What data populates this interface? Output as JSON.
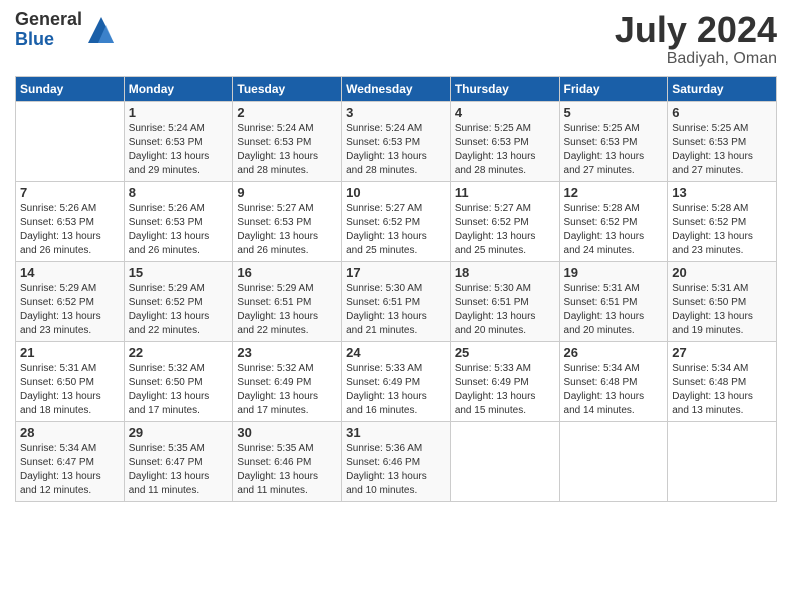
{
  "logo": {
    "general": "General",
    "blue": "Blue"
  },
  "title": "July 2024",
  "location": "Badiyah, Oman",
  "headers": [
    "Sunday",
    "Monday",
    "Tuesday",
    "Wednesday",
    "Thursday",
    "Friday",
    "Saturday"
  ],
  "weeks": [
    [
      {
        "day": "",
        "info": ""
      },
      {
        "day": "1",
        "info": "Sunrise: 5:24 AM\nSunset: 6:53 PM\nDaylight: 13 hours\nand 29 minutes."
      },
      {
        "day": "2",
        "info": "Sunrise: 5:24 AM\nSunset: 6:53 PM\nDaylight: 13 hours\nand 28 minutes."
      },
      {
        "day": "3",
        "info": "Sunrise: 5:24 AM\nSunset: 6:53 PM\nDaylight: 13 hours\nand 28 minutes."
      },
      {
        "day": "4",
        "info": "Sunrise: 5:25 AM\nSunset: 6:53 PM\nDaylight: 13 hours\nand 28 minutes."
      },
      {
        "day": "5",
        "info": "Sunrise: 5:25 AM\nSunset: 6:53 PM\nDaylight: 13 hours\nand 27 minutes."
      },
      {
        "day": "6",
        "info": "Sunrise: 5:25 AM\nSunset: 6:53 PM\nDaylight: 13 hours\nand 27 minutes."
      }
    ],
    [
      {
        "day": "7",
        "info": "Sunrise: 5:26 AM\nSunset: 6:53 PM\nDaylight: 13 hours\nand 26 minutes."
      },
      {
        "day": "8",
        "info": "Sunrise: 5:26 AM\nSunset: 6:53 PM\nDaylight: 13 hours\nand 26 minutes."
      },
      {
        "day": "9",
        "info": "Sunrise: 5:27 AM\nSunset: 6:53 PM\nDaylight: 13 hours\nand 26 minutes."
      },
      {
        "day": "10",
        "info": "Sunrise: 5:27 AM\nSunset: 6:52 PM\nDaylight: 13 hours\nand 25 minutes."
      },
      {
        "day": "11",
        "info": "Sunrise: 5:27 AM\nSunset: 6:52 PM\nDaylight: 13 hours\nand 25 minutes."
      },
      {
        "day": "12",
        "info": "Sunrise: 5:28 AM\nSunset: 6:52 PM\nDaylight: 13 hours\nand 24 minutes."
      },
      {
        "day": "13",
        "info": "Sunrise: 5:28 AM\nSunset: 6:52 PM\nDaylight: 13 hours\nand 23 minutes."
      }
    ],
    [
      {
        "day": "14",
        "info": "Sunrise: 5:29 AM\nSunset: 6:52 PM\nDaylight: 13 hours\nand 23 minutes."
      },
      {
        "day": "15",
        "info": "Sunrise: 5:29 AM\nSunset: 6:52 PM\nDaylight: 13 hours\nand 22 minutes."
      },
      {
        "day": "16",
        "info": "Sunrise: 5:29 AM\nSunset: 6:51 PM\nDaylight: 13 hours\nand 22 minutes."
      },
      {
        "day": "17",
        "info": "Sunrise: 5:30 AM\nSunset: 6:51 PM\nDaylight: 13 hours\nand 21 minutes."
      },
      {
        "day": "18",
        "info": "Sunrise: 5:30 AM\nSunset: 6:51 PM\nDaylight: 13 hours\nand 20 minutes."
      },
      {
        "day": "19",
        "info": "Sunrise: 5:31 AM\nSunset: 6:51 PM\nDaylight: 13 hours\nand 20 minutes."
      },
      {
        "day": "20",
        "info": "Sunrise: 5:31 AM\nSunset: 6:50 PM\nDaylight: 13 hours\nand 19 minutes."
      }
    ],
    [
      {
        "day": "21",
        "info": "Sunrise: 5:31 AM\nSunset: 6:50 PM\nDaylight: 13 hours\nand 18 minutes."
      },
      {
        "day": "22",
        "info": "Sunrise: 5:32 AM\nSunset: 6:50 PM\nDaylight: 13 hours\nand 17 minutes."
      },
      {
        "day": "23",
        "info": "Sunrise: 5:32 AM\nSunset: 6:49 PM\nDaylight: 13 hours\nand 17 minutes."
      },
      {
        "day": "24",
        "info": "Sunrise: 5:33 AM\nSunset: 6:49 PM\nDaylight: 13 hours\nand 16 minutes."
      },
      {
        "day": "25",
        "info": "Sunrise: 5:33 AM\nSunset: 6:49 PM\nDaylight: 13 hours\nand 15 minutes."
      },
      {
        "day": "26",
        "info": "Sunrise: 5:34 AM\nSunset: 6:48 PM\nDaylight: 13 hours\nand 14 minutes."
      },
      {
        "day": "27",
        "info": "Sunrise: 5:34 AM\nSunset: 6:48 PM\nDaylight: 13 hours\nand 13 minutes."
      }
    ],
    [
      {
        "day": "28",
        "info": "Sunrise: 5:34 AM\nSunset: 6:47 PM\nDaylight: 13 hours\nand 12 minutes."
      },
      {
        "day": "29",
        "info": "Sunrise: 5:35 AM\nSunset: 6:47 PM\nDaylight: 13 hours\nand 11 minutes."
      },
      {
        "day": "30",
        "info": "Sunrise: 5:35 AM\nSunset: 6:46 PM\nDaylight: 13 hours\nand 11 minutes."
      },
      {
        "day": "31",
        "info": "Sunrise: 5:36 AM\nSunset: 6:46 PM\nDaylight: 13 hours\nand 10 minutes."
      },
      {
        "day": "",
        "info": ""
      },
      {
        "day": "",
        "info": ""
      },
      {
        "day": "",
        "info": ""
      }
    ]
  ]
}
